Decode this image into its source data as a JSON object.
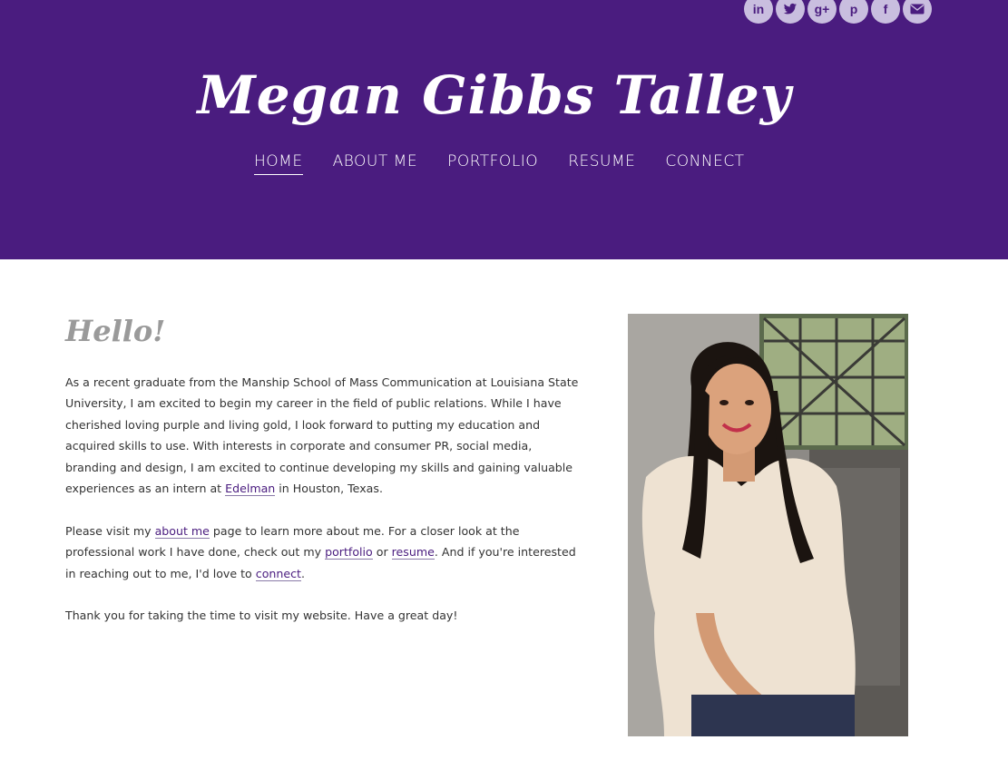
{
  "header": {
    "background_color": "#4a1c7f",
    "site_title": "Megan Gibbs Talley",
    "social": [
      {
        "name": "linkedin",
        "icon": "linkedin-icon",
        "glyph": "in"
      },
      {
        "name": "twitter",
        "icon": "twitter-icon",
        "glyph": ""
      },
      {
        "name": "google-plus",
        "icon": "google-plus-icon",
        "glyph": "g+"
      },
      {
        "name": "pinterest",
        "icon": "pinterest-icon",
        "glyph": "p"
      },
      {
        "name": "facebook",
        "icon": "facebook-icon",
        "glyph": "f"
      },
      {
        "name": "email",
        "icon": "mail-icon",
        "glyph": ""
      }
    ]
  },
  "nav": {
    "items": [
      {
        "label": "HOME",
        "active": true
      },
      {
        "label": "ABOUT ME",
        "active": false
      },
      {
        "label": "PORTFOLIO",
        "active": false
      },
      {
        "label": "RESUME",
        "active": false
      },
      {
        "label": "CONNECT",
        "active": false
      }
    ]
  },
  "main": {
    "heading": "Hello!",
    "p1": {
      "text_before": "As a recent graduate from the Manship School of Mass Communication at Louisiana State University, I am excited to begin my career in the field of public relations. While I have cherished loving purple and living gold, I look forward to putting my education and acquired skills to use. With interests in corporate and consumer PR, social media, branding and design, I am excited to continue developing my skills and gaining valuable experiences as an intern at ",
      "link": "Edelman",
      "text_after": " in Houston, Texas."
    },
    "p2": {
      "t1": "Please visit my ",
      "link1": "about me",
      "t2": " page to learn more about me. For a closer look at the professional work I have done, check out my ",
      "link2": "portfolio",
      "t3": " or ",
      "link3": "resume",
      "t4": ". And if you're interested in reaching out to me, I'd love to ",
      "link4": "connect",
      "t5": "."
    },
    "p3": "Thank you for taking the time to visit my website. Have a great day!"
  },
  "photo": {
    "icon": "portrait-photo"
  }
}
